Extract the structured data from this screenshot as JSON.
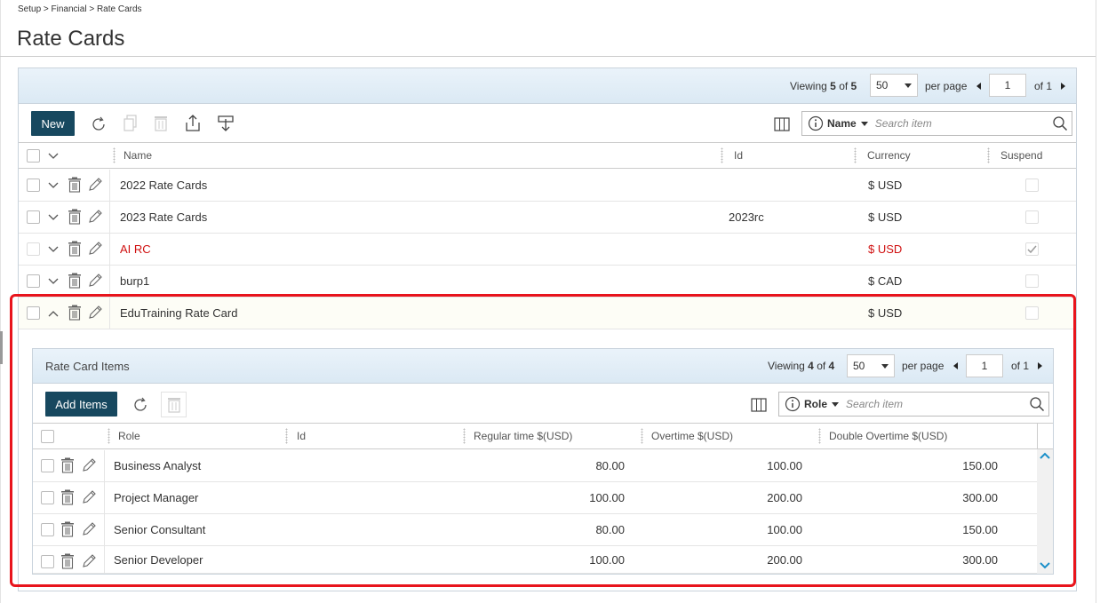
{
  "breadcrumb": "Setup > Financial > Rate Cards",
  "page_title": "Rate Cards",
  "main_grid": {
    "viewing_prefix": "Viewing",
    "viewing_count": "5",
    "viewing_of": "of",
    "viewing_total": "5",
    "per_page_value": "50",
    "per_page_label": "per page",
    "page_value": "1",
    "of_pages": "of 1",
    "new_label": "New",
    "search_field": "Name",
    "search_placeholder": "Search item",
    "columns": [
      "Name",
      "Id",
      "Currency",
      "Suspend"
    ],
    "rows": [
      {
        "name": "2022 Rate Cards",
        "id": "",
        "currency": "$ USD",
        "suspended": false,
        "red": false
      },
      {
        "name": "2023 Rate Cards",
        "id": "2023rc",
        "currency": "$ USD",
        "suspended": false,
        "red": false
      },
      {
        "name": "AI RC",
        "id": "",
        "currency": "$ USD",
        "suspended": true,
        "red": true
      },
      {
        "name": "burp1",
        "id": "",
        "currency": "$ CAD",
        "suspended": false,
        "red": false
      },
      {
        "name": "EduTraining Rate Card",
        "id": "",
        "currency": "$ USD",
        "suspended": false,
        "red": false
      }
    ]
  },
  "sub_grid": {
    "title": "Rate Card Items",
    "viewing_prefix": "Viewing",
    "viewing_count": "4",
    "viewing_of": "of",
    "viewing_total": "4",
    "per_page_value": "50",
    "per_page_label": "per page",
    "page_value": "1",
    "of_pages": "of 1",
    "add_label": "Add Items",
    "search_field": "Role",
    "search_placeholder": "Search item",
    "columns": [
      "Role",
      "Id",
      "Regular time $(USD)",
      "Overtime $(USD)",
      "Double Overtime $(USD)"
    ],
    "rows": [
      {
        "role": "Business Analyst",
        "id": "",
        "regular": "80.00",
        "overtime": "100.00",
        "double": "150.00"
      },
      {
        "role": "Project Manager",
        "id": "",
        "regular": "100.00",
        "overtime": "200.00",
        "double": "300.00"
      },
      {
        "role": "Senior Consultant",
        "id": "",
        "regular": "80.00",
        "overtime": "100.00",
        "double": "150.00"
      },
      {
        "role": "Senior Developer",
        "id": "",
        "regular": "100.00",
        "overtime": "200.00",
        "double": "300.00"
      }
    ]
  },
  "colors": {
    "primary": "#17485f",
    "highlight": "#e8141c",
    "suspended_text": "#d01111",
    "header_bg": "#dbe9f4"
  }
}
